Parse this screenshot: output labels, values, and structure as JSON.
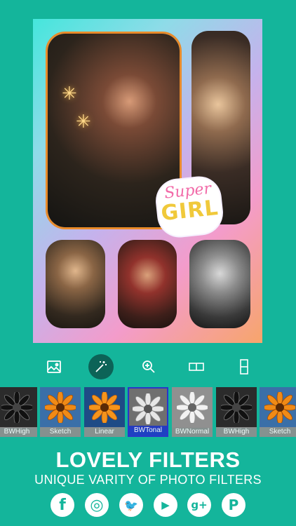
{
  "canvas": {
    "sticker_line1": "Super",
    "sticker_line2": "GIRL"
  },
  "toolbar": {
    "tools": [
      {
        "name": "image-icon"
      },
      {
        "name": "magic-wand-icon",
        "active": true
      },
      {
        "name": "zoom-icon"
      },
      {
        "name": "split-horizontal-icon"
      },
      {
        "name": "split-vertical-icon"
      }
    ]
  },
  "filters": [
    {
      "label": "BWHigh",
      "style": "bw"
    },
    {
      "label": "Sketch",
      "style": "color"
    },
    {
      "label": "Linear",
      "style": "color"
    },
    {
      "label": "BWTonal",
      "style": "bwlight",
      "selected": true
    },
    {
      "label": "BWNormal",
      "style": "bwlight"
    },
    {
      "label": "BWHigh",
      "style": "bw"
    },
    {
      "label": "Sketch",
      "style": "color"
    }
  ],
  "promo": {
    "headline": "LOVELY FILTERS",
    "subline": "UNIQUE VARITY OF PHOTO FILTERS"
  },
  "social": [
    {
      "name": "facebook-icon",
      "glyph": "f"
    },
    {
      "name": "instagram-icon",
      "glyph": "◎"
    },
    {
      "name": "twitter-icon",
      "glyph": "🐦"
    },
    {
      "name": "youtube-icon",
      "glyph": "▶"
    },
    {
      "name": "google-plus-icon",
      "glyph": "g+"
    },
    {
      "name": "pinterest-icon",
      "glyph": "P"
    }
  ],
  "colors": {
    "background": "#14b59b",
    "accent_dark": "#0c6357",
    "selected_filter": "#1f38c6"
  }
}
